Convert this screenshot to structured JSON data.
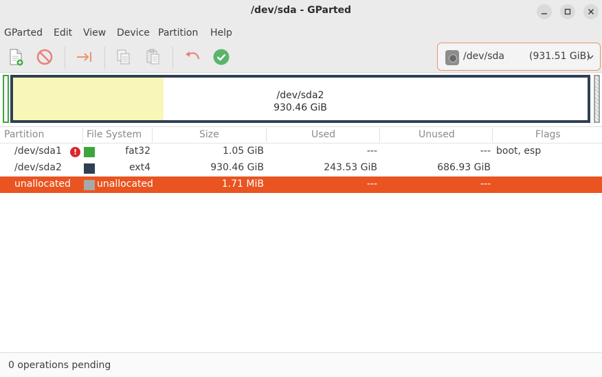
{
  "window": {
    "title": "/dev/sda - GParted"
  },
  "menu": [
    "GParted",
    "Edit",
    "View",
    "Device",
    "Partition",
    "Help"
  ],
  "toolbar": {
    "icons": [
      "new-partition-icon",
      "delete-icon",
      "resize-move-icon",
      "copy-icon",
      "paste-icon",
      "undo-icon",
      "apply-icon"
    ]
  },
  "device": {
    "name": "/dev/sda",
    "size": "(931.51 GiB)"
  },
  "diskmap": {
    "label": "/dev/sda2",
    "size": "930.46 GiB",
    "used_fraction": 0.262
  },
  "table": {
    "headers": [
      "Partition",
      "File System",
      "Size",
      "Used",
      "Unused",
      "Flags"
    ],
    "rows": [
      {
        "partition": "/dev/sda1",
        "fs": "fat32",
        "size": "1.05 GiB",
        "used": "---",
        "unused": "---",
        "flags": "boot, esp",
        "color": "#3ea53e",
        "warning": "!"
      },
      {
        "partition": "/dev/sda2",
        "fs": "ext4",
        "size": "930.46 GiB",
        "used": "243.53 GiB",
        "unused": "686.93 GiB",
        "flags": "",
        "color": "#2f4055"
      },
      {
        "partition": "unallocated",
        "fs": "unallocated",
        "size": "1.71 MiB",
        "used": "---",
        "unused": "---",
        "flags": "",
        "color": "#a8a8a8"
      }
    ]
  },
  "status": {
    "text": "0 operations pending"
  },
  "colors": {
    "accent": "#e95420",
    "selection": "#e95420",
    "ext4": "#2f4055",
    "fat32": "#3ea53e",
    "unallocated": "#a8a8a8"
  }
}
